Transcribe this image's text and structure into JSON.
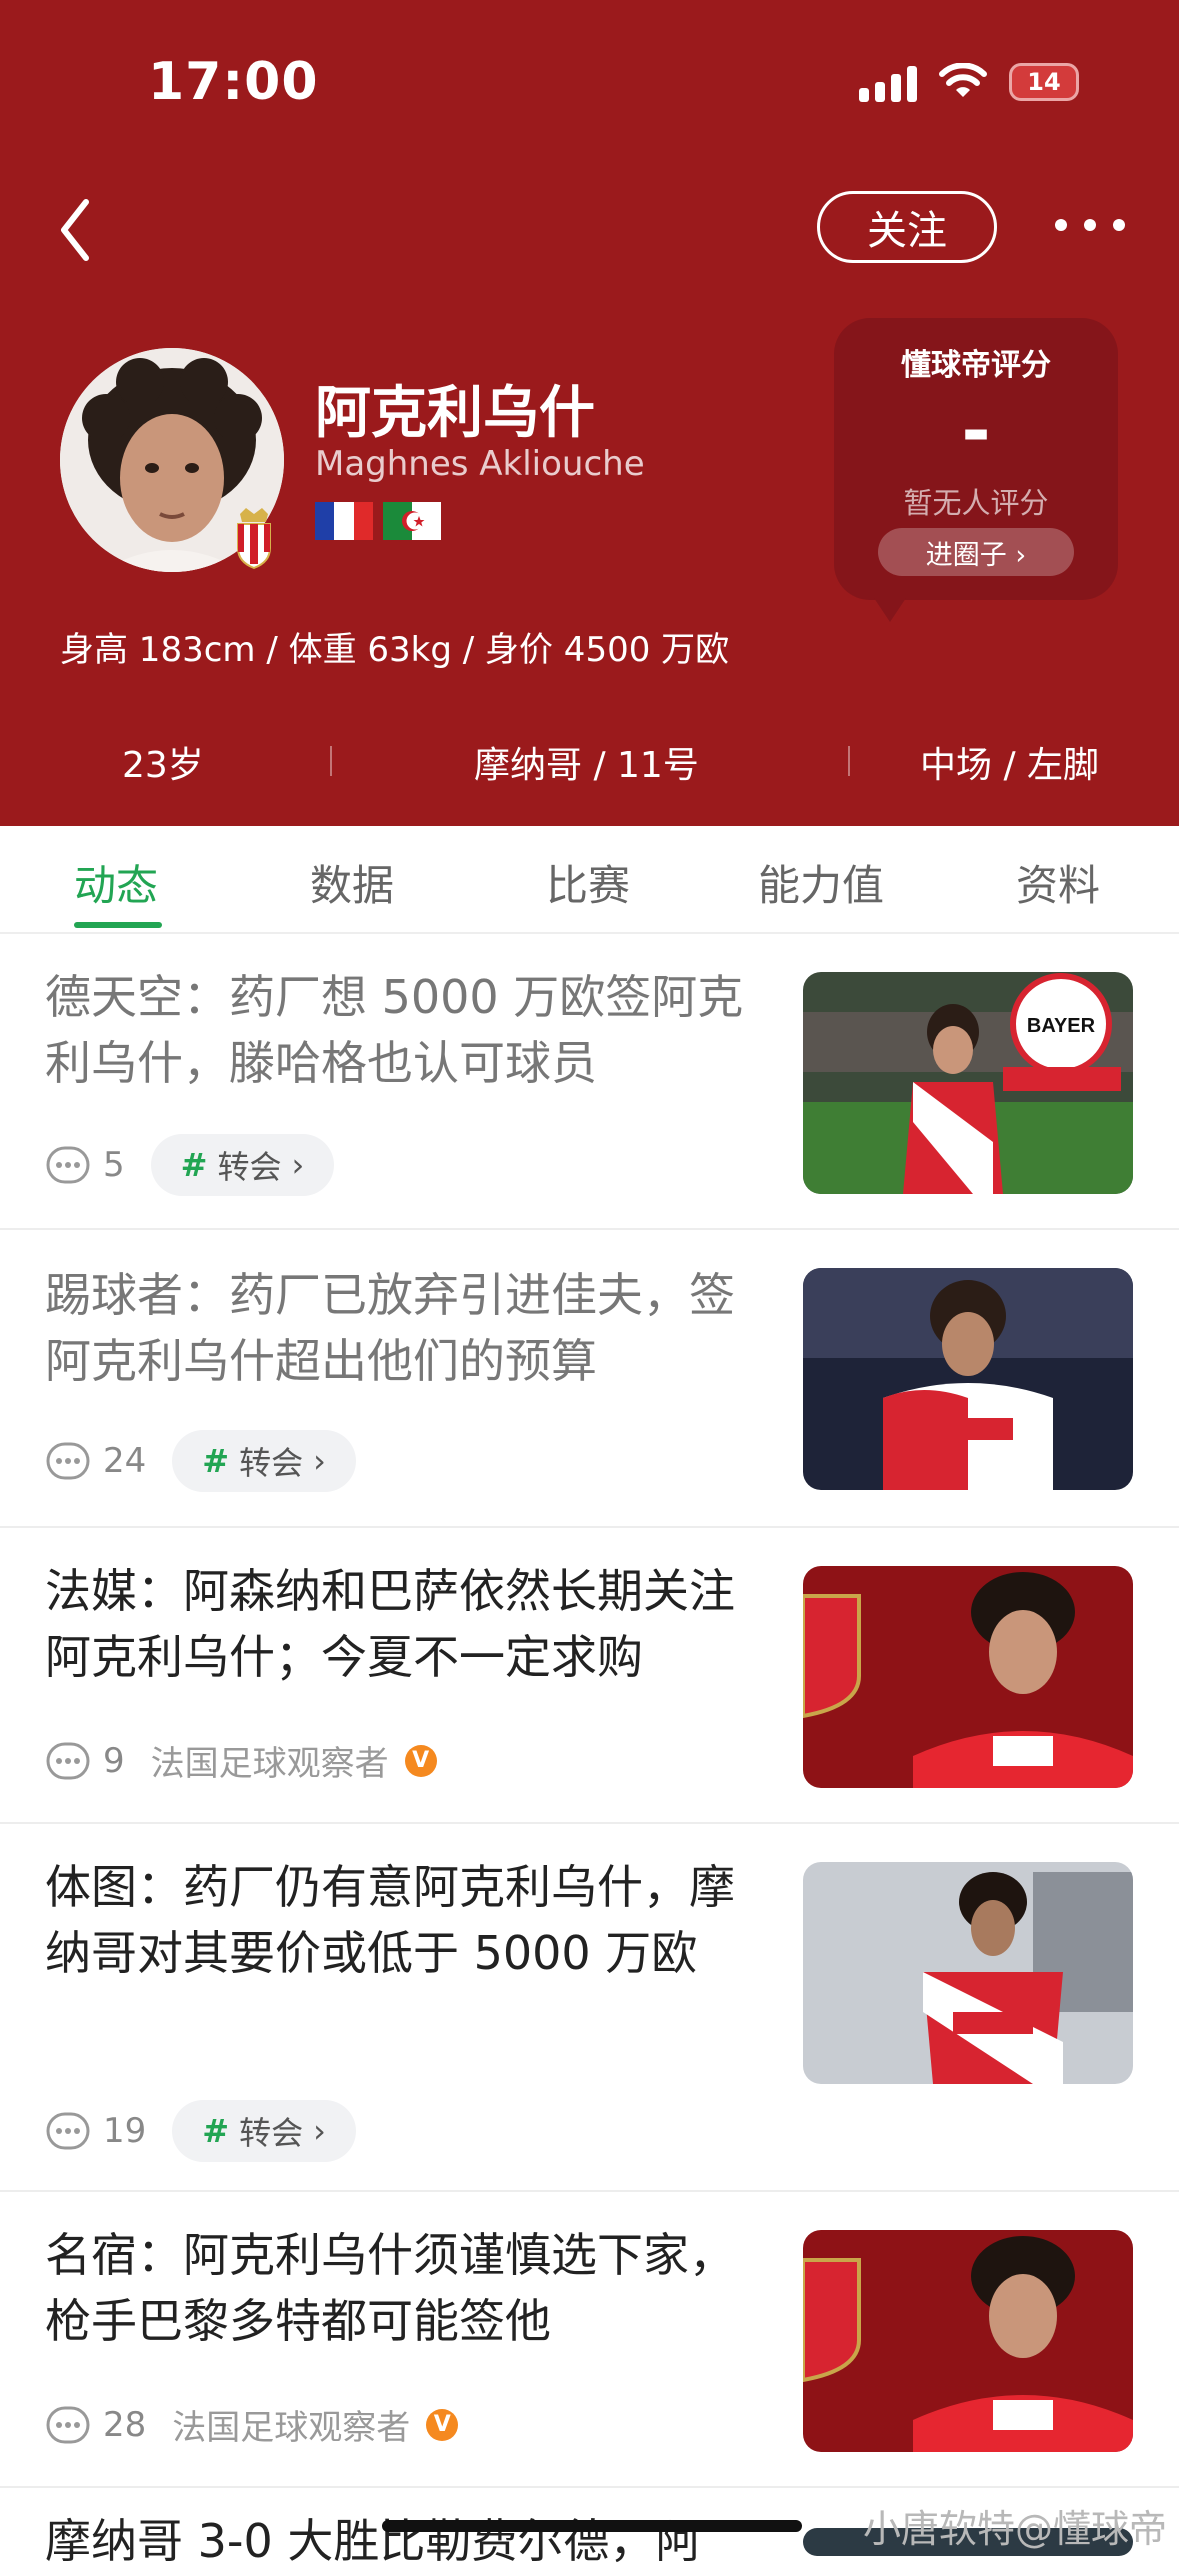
{
  "status_bar": {
    "time": "17:00",
    "battery": "14"
  },
  "header": {
    "follow_label": "关注",
    "player": {
      "name_cn": "阿克利乌什",
      "name_en": "Maghnes Akliouche",
      "flags": [
        "france-flag",
        "algeria-flag"
      ],
      "stats_line": "身高 183cm / 体重 63kg / 身价 4500 万欧"
    },
    "rating": {
      "title": "懂球帝评分",
      "value": "-",
      "note": "暂无人评分",
      "button": "进圈子 ›"
    },
    "info": {
      "age": "23岁",
      "club": "摩纳哥 / 11号",
      "position": "中场 / 左脚"
    }
  },
  "tabs": [
    {
      "label": "动态",
      "active": true
    },
    {
      "label": "数据",
      "active": false
    },
    {
      "label": "比赛",
      "active": false
    },
    {
      "label": "能力值",
      "active": false
    },
    {
      "label": "资料",
      "active": false
    }
  ],
  "news": [
    {
      "title": "德天空：药厂想 5000 万欧签阿克利乌什，滕哈格也认可球员",
      "comments": "5",
      "tag": "转会",
      "read": true
    },
    {
      "title": "踢球者：药厂已放弃引进佳夫，签阿克利乌什超出他们的预算",
      "comments": "24",
      "tag": "转会",
      "read": true
    },
    {
      "title": "法媒：阿森纳和巴萨依然长期关注阿克利乌什；今夏不一定求购",
      "comments": "9",
      "author": "法国足球观察者",
      "read": false
    },
    {
      "title": "体图：药厂仍有意阿克利乌什，摩纳哥对其要价或低于 5000 万欧",
      "comments": "19",
      "tag": "转会",
      "read": false
    },
    {
      "title": "名宿：阿克利乌什须谨慎选下家，枪手巴黎多特都可能签他",
      "comments": "28",
      "author": "法国足球观察者",
      "read": false
    },
    {
      "title": "摩纳哥 3-0 大胜比勒费尔德，阿",
      "read": false
    }
  ],
  "tag_chevron": "›",
  "verified_mark": "V",
  "watermark": "小唐软特@懂球帝",
  "colors": {
    "header_bg": "#9b1a1c",
    "accent": "#22a553",
    "verified": "#f5891f"
  }
}
